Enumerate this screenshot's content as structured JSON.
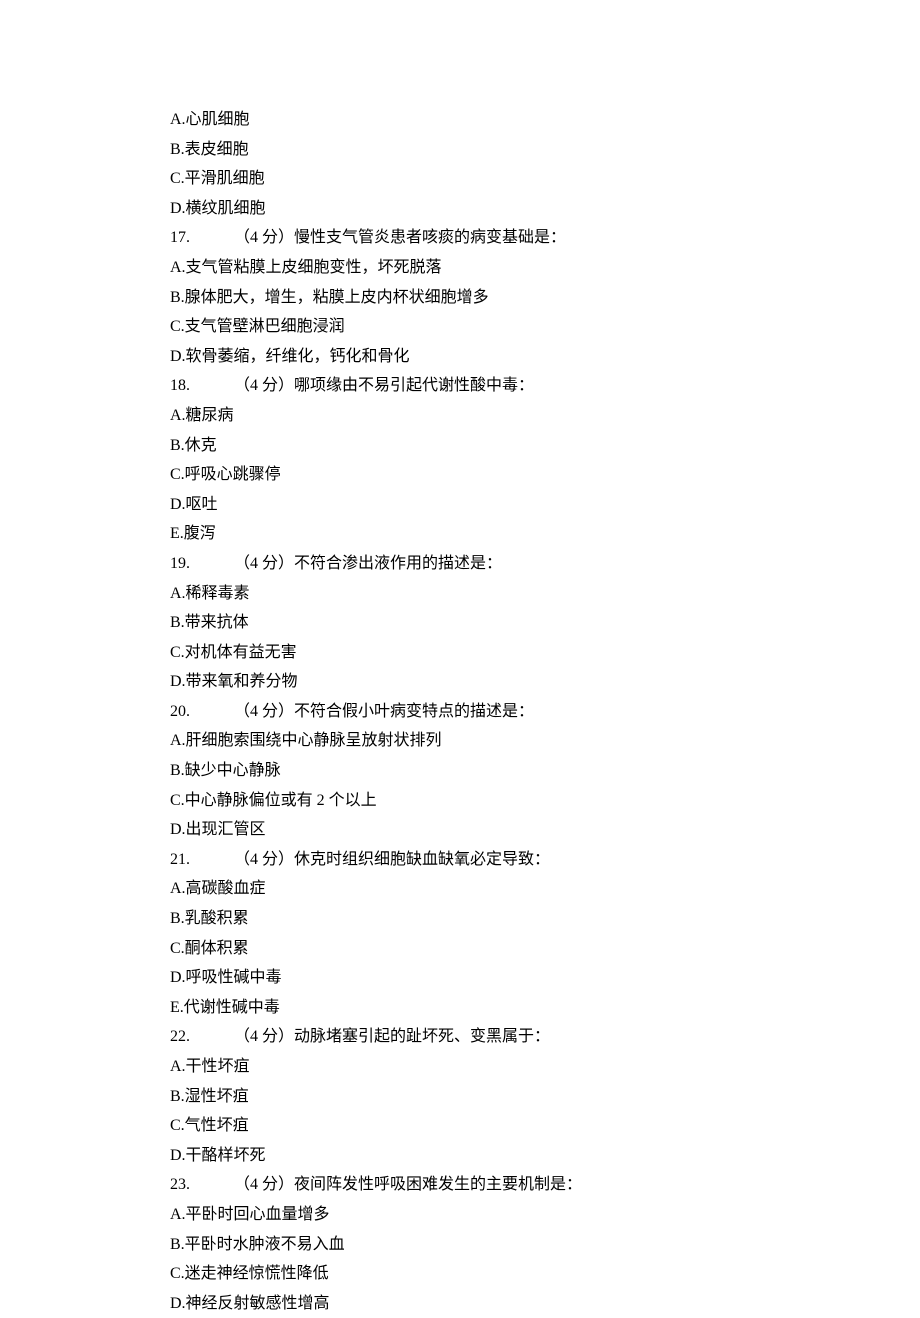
{
  "lines": [
    {
      "text": "A.心肌细胞"
    },
    {
      "text": "B.表皮细胞"
    },
    {
      "text": "C.平滑肌细胞"
    },
    {
      "text": "D.横纹肌细胞"
    },
    {
      "qnum": "17.",
      "qtext": "（4 分）慢性支气管炎患者咳痰的病变基础是："
    },
    {
      "text": "A.支气管粘膜上皮细胞变性，坏死脱落"
    },
    {
      "text": "B.腺体肥大，增生，粘膜上皮内杯状细胞增多"
    },
    {
      "text": "C.支气管壁淋巴细胞浸润"
    },
    {
      "text": "D.软骨萎缩，纤维化，钙化和骨化"
    },
    {
      "qnum": "18.",
      "qtext": "（4 分）哪项缘由不易引起代谢性酸中毒："
    },
    {
      "text": "A.糖尿病"
    },
    {
      "text": "B.休克"
    },
    {
      "text": "C.呼吸心跳骤停"
    },
    {
      "text": "D.呕吐"
    },
    {
      "text": "E.腹泻"
    },
    {
      "qnum": "19.",
      "qtext": "（4 分）不符合渗出液作用的描述是："
    },
    {
      "text": "A.稀释毒素"
    },
    {
      "text": "B.带来抗体"
    },
    {
      "text": "C.对机体有益无害"
    },
    {
      "text": "D.带来氧和养分物"
    },
    {
      "qnum": "20.",
      "qtext": "（4 分）不符合假小叶病变特点的描述是："
    },
    {
      "text": "A.肝细胞索围绕中心静脉呈放射状排列"
    },
    {
      "text": "B.缺少中心静脉"
    },
    {
      "text": "C.中心静脉偏位或有 2 个以上"
    },
    {
      "text": "D.出现汇管区"
    },
    {
      "qnum": "21.",
      "qtext": "（4 分）休克时组织细胞缺血缺氧必定导致："
    },
    {
      "text": "A.高碳酸血症"
    },
    {
      "text": "B.乳酸积累"
    },
    {
      "text": "C.酮体积累"
    },
    {
      "text": "D.呼吸性碱中毒"
    },
    {
      "text": "E.代谢性碱中毒"
    },
    {
      "qnum": "22.",
      "qtext": "（4 分）动脉堵塞引起的趾坏死、变黑属于："
    },
    {
      "text": "A.干性坏疽"
    },
    {
      "text": "B.湿性坏疽"
    },
    {
      "text": "C.气性坏疽"
    },
    {
      "text": "D.干酪样坏死"
    },
    {
      "qnum": "23.",
      "qtext": "（4 分）夜间阵发性呼吸困难发生的主要机制是："
    },
    {
      "text": "A.平卧时回心血量增多"
    },
    {
      "text": "B.平卧时水肿液不易入血"
    },
    {
      "text": "C.迷走神经惊慌性降低"
    },
    {
      "text": "D.神经反射敏感性增高"
    }
  ]
}
